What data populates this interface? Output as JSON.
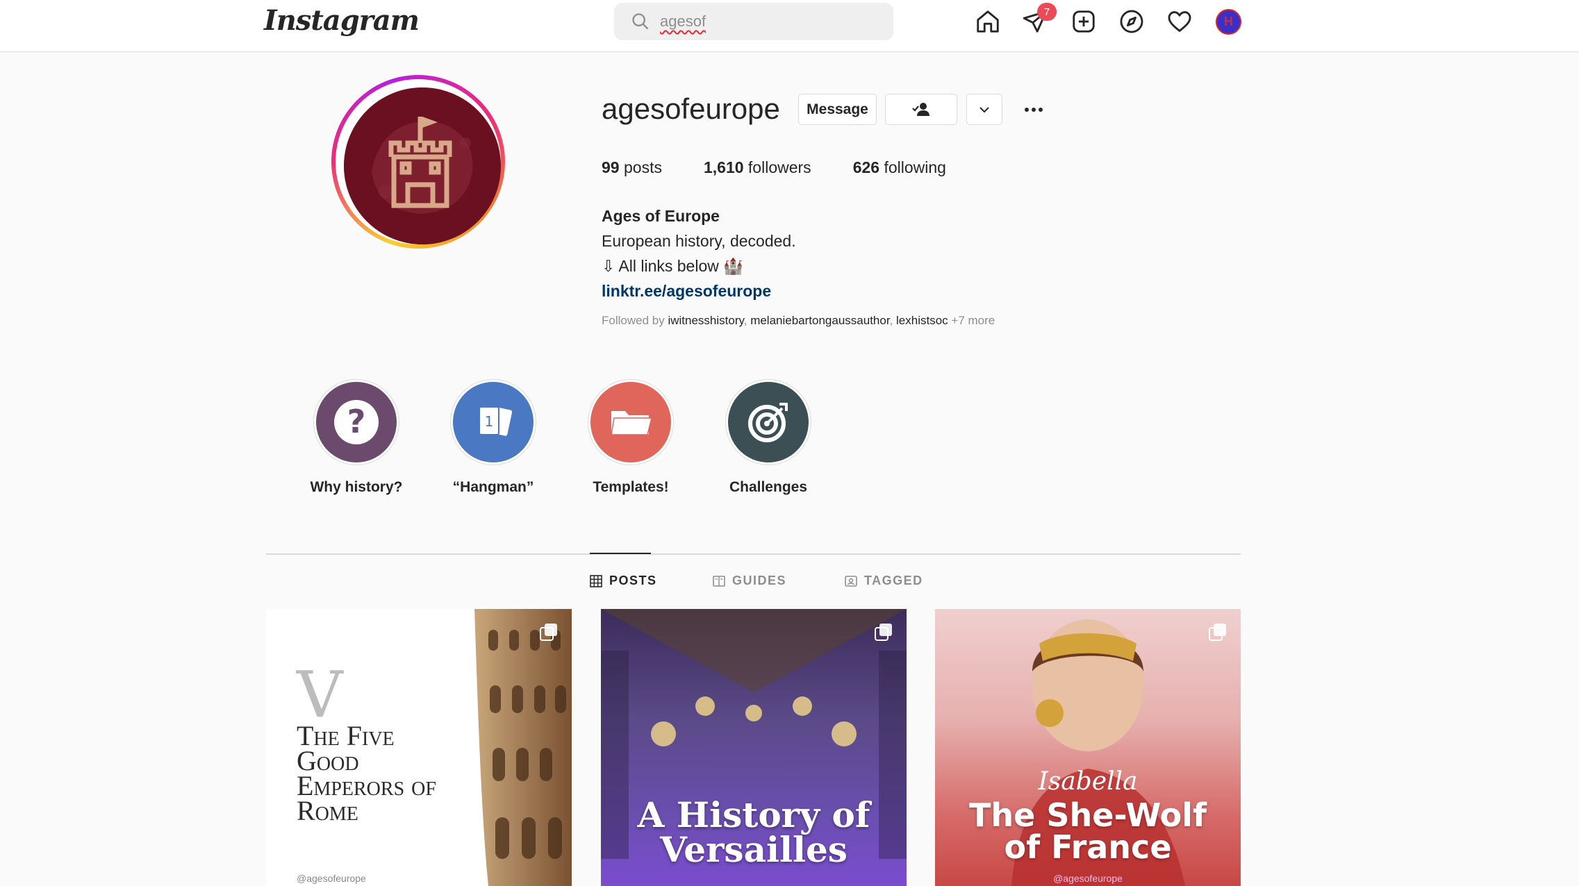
{
  "nav": {
    "logo": "Instagram",
    "search_value": "agesof",
    "notification_count": "7",
    "avatar_initial": "H"
  },
  "profile": {
    "username": "agesofeurope",
    "message_label": "Message",
    "posts_count": "99",
    "posts_label": "posts",
    "followers_count": "1,610",
    "followers_label": "followers",
    "following_count": "626",
    "following_label": "following",
    "display_name": "Ages of Europe",
    "bio_line1": "European history, decoded.",
    "bio_line2": "⇩ All links below 🏰",
    "link": "linktr.ee/agesofeurope",
    "followed_by_prefix": "Followed by",
    "followed_by_users": [
      "iwitnesshistory",
      "melaniebartongaussauthor",
      "lexhistsoc"
    ],
    "followed_by_more": "+7 more"
  },
  "highlights": [
    {
      "label": "Why history?",
      "color": "#6b4a6e"
    },
    {
      "label": "“Hangman”",
      "color": "#4a78c2"
    },
    {
      "label": "Templates!",
      "color": "#e0655a"
    },
    {
      "label": "Challenges",
      "color": "#3b4f55"
    }
  ],
  "tabs": {
    "posts": "POSTS",
    "guides": "GUIDES",
    "tagged": "TAGGED"
  },
  "posts": [
    {
      "numeral": "V",
      "title": "The Five Good Emperors of Rome",
      "handle": "@agesofeurope"
    },
    {
      "title": "A History of Versailles"
    },
    {
      "subtitle": "Isabella",
      "title": "The She-Wolf of France",
      "handle": "@agesofeurope"
    }
  ],
  "colors": {
    "accent_link": "#00376b",
    "badge": "#ed4956",
    "border": "#dbdbdb"
  }
}
